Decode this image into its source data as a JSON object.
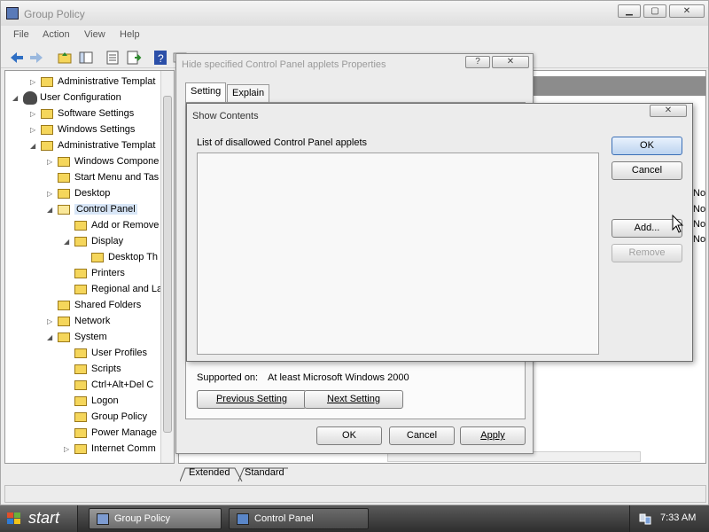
{
  "window": {
    "title": "Group Policy",
    "menu": [
      "File",
      "Action",
      "View",
      "Help"
    ]
  },
  "tree": {
    "items": [
      {
        "label": "Administrative Templat",
        "depth": 1,
        "expander": "▷",
        "icon": "folder"
      },
      {
        "label": "User Configuration",
        "depth": 0,
        "expander": "◢",
        "icon": "user"
      },
      {
        "label": "Software Settings",
        "depth": 1,
        "expander": "▷",
        "icon": "folder"
      },
      {
        "label": "Windows Settings",
        "depth": 1,
        "expander": "▷",
        "icon": "folder"
      },
      {
        "label": "Administrative Templat",
        "depth": 1,
        "expander": "◢",
        "icon": "folder"
      },
      {
        "label": "Windows Compone",
        "depth": 2,
        "expander": "▷",
        "icon": "folder"
      },
      {
        "label": "Start Menu and Tas",
        "depth": 2,
        "expander": "",
        "icon": "folder"
      },
      {
        "label": "Desktop",
        "depth": 2,
        "expander": "▷",
        "icon": "folder"
      },
      {
        "label": "Control Panel",
        "depth": 2,
        "expander": "◢",
        "icon": "folder-open",
        "selected": true
      },
      {
        "label": "Add or Remove",
        "depth": 3,
        "expander": "",
        "icon": "folder"
      },
      {
        "label": "Display",
        "depth": 3,
        "expander": "◢",
        "icon": "folder"
      },
      {
        "label": "Desktop Th",
        "depth": 4,
        "expander": "",
        "icon": "folder"
      },
      {
        "label": "Printers",
        "depth": 3,
        "expander": "",
        "icon": "folder"
      },
      {
        "label": "Regional and La",
        "depth": 3,
        "expander": "",
        "icon": "folder"
      },
      {
        "label": "Shared Folders",
        "depth": 2,
        "expander": "",
        "icon": "folder"
      },
      {
        "label": "Network",
        "depth": 2,
        "expander": "▷",
        "icon": "folder"
      },
      {
        "label": "System",
        "depth": 2,
        "expander": "◢",
        "icon": "folder"
      },
      {
        "label": "User Profiles",
        "depth": 3,
        "expander": "",
        "icon": "folder"
      },
      {
        "label": "Scripts",
        "depth": 3,
        "expander": "",
        "icon": "folder"
      },
      {
        "label": "Ctrl+Alt+Del C",
        "depth": 3,
        "expander": "",
        "icon": "folder"
      },
      {
        "label": "Logon",
        "depth": 3,
        "expander": "",
        "icon": "folder"
      },
      {
        "label": "Group Policy",
        "depth": 3,
        "expander": "",
        "icon": "folder"
      },
      {
        "label": "Power Manage",
        "depth": 3,
        "expander": "",
        "icon": "folder"
      },
      {
        "label": "Internet Comm",
        "depth": 3,
        "expander": "▷",
        "icon": "folder"
      }
    ]
  },
  "right_panel": {
    "no_values": [
      "No",
      "No",
      "No",
      "No"
    ],
    "tabs": [
      "Extended",
      "Standard"
    ]
  },
  "props_dialog": {
    "title": "Hide specified Control Panel applets Properties",
    "tabs": [
      "Setting",
      "Explain"
    ],
    "supported_label": "Supported on:",
    "supported_value": "At least Microsoft Windows 2000",
    "previous_setting": "Previous Setting",
    "next_setting": "Next Setting",
    "ok": "OK",
    "cancel": "Cancel",
    "apply": "Apply",
    "help_btn": "?",
    "close_btn": "✕"
  },
  "show_dialog": {
    "title": "Show Contents",
    "list_label": "List of disallowed Control Panel applets",
    "ok": "OK",
    "cancel": "Cancel",
    "add": "Add...",
    "remove": "Remove",
    "close_btn": "✕"
  },
  "taskbar": {
    "start": "start",
    "tasks": [
      {
        "label": "Group Policy",
        "active": true
      },
      {
        "label": "Control Panel",
        "active": false
      }
    ],
    "clock": "7:33 AM"
  },
  "colors": {
    "accent": "#3b6fb6",
    "selection": "#d8e6f7",
    "folder": "#f5d65b"
  }
}
